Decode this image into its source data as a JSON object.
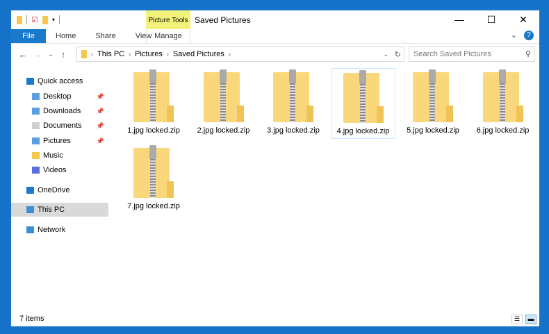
{
  "window": {
    "title": "Saved Pictures",
    "context_tab": "Picture Tools"
  },
  "ribbon": {
    "tabs": [
      "File",
      "Home",
      "Share",
      "View",
      "Manage"
    ]
  },
  "nav": {
    "breadcrumb": [
      "This PC",
      "Pictures",
      "Saved Pictures"
    ],
    "search_placeholder": "Search Saved Pictures"
  },
  "sidebar": [
    {
      "label": "Quick access",
      "icon": "star-icon",
      "color": "#1979ca"
    },
    {
      "label": "Desktop",
      "icon": "folder-icon",
      "pinned": true,
      "color": "#5aa0e0"
    },
    {
      "label": "Downloads",
      "icon": "download-folder-icon",
      "pinned": true,
      "color": "#5aa0e0"
    },
    {
      "label": "Documents",
      "icon": "documents-icon",
      "pinned": true,
      "color": "#d0d0d0"
    },
    {
      "label": "Pictures",
      "icon": "pictures-icon",
      "pinned": true,
      "color": "#5aa0e0"
    },
    {
      "label": "Music",
      "icon": "music-icon",
      "color": "#f5c74f"
    },
    {
      "label": "Videos",
      "icon": "videos-icon",
      "color": "#5a6ee0"
    },
    {
      "label": "OneDrive",
      "icon": "cloud-icon",
      "color": "#1979ca"
    },
    {
      "label": "This PC",
      "icon": "computer-icon",
      "selected": true,
      "color": "#3c8fd6"
    },
    {
      "label": "Network",
      "icon": "network-icon",
      "color": "#3c8fd6"
    }
  ],
  "files": [
    "1.jpg locked.zip",
    "2.jpg locked.zip",
    "3.jpg locked.zip",
    "4.jpg locked.zip",
    "5.jpg locked.zip",
    "6.jpg locked.zip",
    "7.jpg locked.zip"
  ],
  "status": {
    "count": "7 items"
  }
}
